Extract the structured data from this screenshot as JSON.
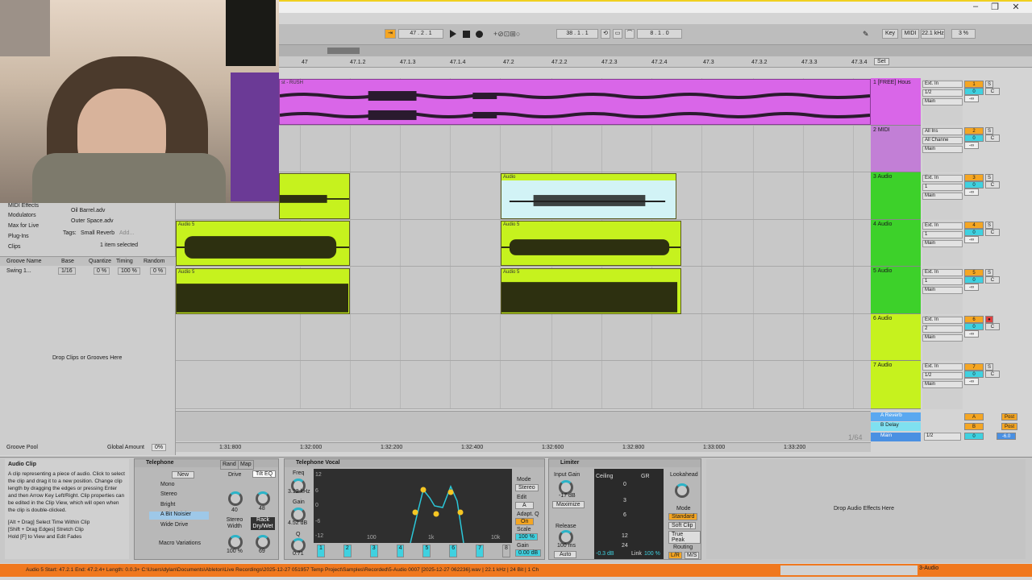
{
  "window": {
    "minimize": "–",
    "maximize": "❐",
    "close": "✕"
  },
  "transport": {
    "follow": "⇥",
    "pos": "47 .  2 .  1",
    "loop_start": "38 .  1 .  1",
    "loop_len": "8 .  1 .  0",
    "key": "Key",
    "midi": "MIDI",
    "sample_rate": "22.1 kHz",
    "cpu": "3 %"
  },
  "ruler": {
    "ticks": [
      "47",
      "47.1.2",
      "47.1.3",
      "47.1.4",
      "47.2",
      "47.2.2",
      "47.2.3",
      "47.2.4",
      "47.3",
      "47.3.2",
      "47.3.3",
      "47.3.4"
    ],
    "set": "Set"
  },
  "timeline": {
    "ticks": [
      "1:31:800",
      "1:32:000",
      "1:32:200",
      "1:32:400",
      "1:32:600",
      "1:32:800",
      "1:33:000",
      "1:33:200"
    ],
    "zoom": "1/64"
  },
  "tracks": [
    {
      "name": "1 [FREE] Hous",
      "input": "Ext. In",
      "ch": "1/2",
      "num": "1",
      "vol": "0",
      "pan": "C",
      "inf": "-∞",
      "color": "#d966e8",
      "out": "Main"
    },
    {
      "name": "2 MIDI",
      "input": "All Ins",
      "ch": "All Channe",
      "num": "2",
      "vol": "0",
      "pan": "C",
      "inf": "-∞",
      "color": "#c27fd6",
      "out": "Main"
    },
    {
      "name": "3 Audio",
      "input": "Ext. In",
      "ch": "1",
      "num": "3",
      "vol": "0",
      "pan": "C",
      "inf": "-∞",
      "color": "#3dd12a",
      "out": "Main"
    },
    {
      "name": "4 Audio",
      "input": "Ext. In",
      "ch": "1",
      "num": "4",
      "vol": "0",
      "pan": "C",
      "inf": "-∞",
      "color": "#3dd12a",
      "out": "Main"
    },
    {
      "name": "5 Audio",
      "input": "Ext. In",
      "ch": "1",
      "num": "5",
      "vol": "0",
      "pan": "C",
      "inf": "-∞",
      "color": "#3dd12a",
      "out": "Main"
    },
    {
      "name": "6 Audio",
      "input": "Ext. In",
      "ch": "2",
      "num": "6",
      "vol": "0",
      "pan": "C",
      "inf": "-∞",
      "color": "#c6f21e",
      "out": "Main"
    },
    {
      "name": "7 Audio",
      "input": "Ext. In",
      "ch": "1/2",
      "num": "7",
      "vol": "0",
      "pan": "C",
      "inf": "-∞",
      "color": "#c6f21e",
      "out": "Main"
    }
  ],
  "returns": [
    {
      "name": "A Reverb",
      "num": "A",
      "post": "Post"
    },
    {
      "name": "B Delay",
      "num": "B",
      "post": "Post"
    },
    {
      "name": "Main",
      "ch": "1/2",
      "vol": "0",
      "val": "-6.0"
    }
  ],
  "clip_label_1": "st - RUSH",
  "clip_label_audio": "Audio",
  "clip_label_audio5": "Audio 5",
  "browser": {
    "items": [
      "MIDI Effects",
      "Modulators",
      "Max for Live",
      "Plug-Ins",
      "Clips"
    ],
    "files": [
      "Oil Barrel.adv",
      "Outer Space.adv"
    ],
    "tags_label": "Tags:",
    "tag": "Small Reverb",
    "add": "Add...",
    "selected": "1 item selected",
    "groove_cols": [
      "Groove Name",
      "Base",
      "Quantize",
      "Timing",
      "Random"
    ],
    "groove_row": {
      "name": "Swing 1...",
      "base": "1/16",
      "quantize": "0 %",
      "timing": "100 %",
      "random": "0 %"
    },
    "drop": "Drop Clips or Grooves Here",
    "pool": "Groove Pool",
    "global_amount": "Global Amount",
    "ga_val": "0%"
  },
  "info": {
    "title": "Audio Clip",
    "body": "A clip representing a piece of audio. Click to select the clip and drag it to a new position. Change clip length by dragging the edges or pressing Enter and then Arrow Key Left/Right. Clip properties can be edited in the Clip View, which will open when the clip is double-clicked.",
    "hint1": "[Alt + Drag] Select Time Within Clip",
    "hint2": "[Shift + Drag Edges] Stretch Clip",
    "hint3": "Hold [F] to View and Edit Fades"
  },
  "rack": {
    "title": "Telephone",
    "rand": "Rand",
    "map": "Map",
    "new": "New",
    "chains": [
      "Mono",
      "Stereo",
      "Bright",
      "A Bit Noisier",
      "Wide Drive"
    ],
    "macro": "Macro Variations",
    "drive": "Drive",
    "tilt": "Tilt EQ",
    "k1": "40",
    "k2": "48",
    "sw": "Stereo Width",
    "sw_val": "100 %",
    "dw": "Rack Dry/Wet",
    "dw_val": "69"
  },
  "eq": {
    "title": "Telephone Vocal",
    "freq": "Freq",
    "freq_val": "3.12 kHz",
    "gain": "Gain",
    "gain_val": "4.52 dB",
    "q": "Q",
    "q_val": "0.71",
    "mode": "Mode",
    "stereo": "Stereo",
    "edit": "Edit",
    "a": "A",
    "adapt": "Adapt. Q",
    "on": "On",
    "scale": "Scale",
    "scale_val": "100 %",
    "gain2": "Gain",
    "gain2_val": "0.00 dB",
    "ylabels": [
      "12",
      "6",
      "0",
      "-6",
      "-12"
    ],
    "xlabels": [
      "100",
      "1k",
      "10k"
    ],
    "bands": [
      "1",
      "2",
      "3",
      "4",
      "5",
      "6",
      "7",
      "8"
    ]
  },
  "limiter": {
    "title": "Limiter",
    "input_gain": "Input Gain",
    "ig_val": "-17 dB",
    "maximize": "Maximize",
    "release": "Release",
    "rel_val": "100 ms",
    "auto": "Auto",
    "ceiling": "Ceiling",
    "gr": "GR",
    "c_val": "-0.3 dB",
    "link": "Link",
    "link_val": "100 %",
    "lookahead": "Lookahead",
    "mode": "Mode",
    "standard": "Standard",
    "soft": "Soft Clip",
    "true_peak": "True Peak",
    "routing": "Routing",
    "lr": "L/R",
    "ms": "M/S",
    "scale": [
      "0",
      "3",
      "6",
      "12",
      "24"
    ]
  },
  "drop_fx": "Drop Audio Effects Here",
  "status": "Audio 5  Start: 47.2.1  End: 47.2.4+  Length: 0.0.3+  C:\\Users\\dylan\\Documents\\Ableton\\Live Recordings\\2025-12-27 051957 Temp Project\\Samples\\Recorded\\5-Audio 0007 [2025-12-27 062236].wav | 22.1 kHz | 24 Bit | 1 Ch",
  "status_track": "3-Audio"
}
